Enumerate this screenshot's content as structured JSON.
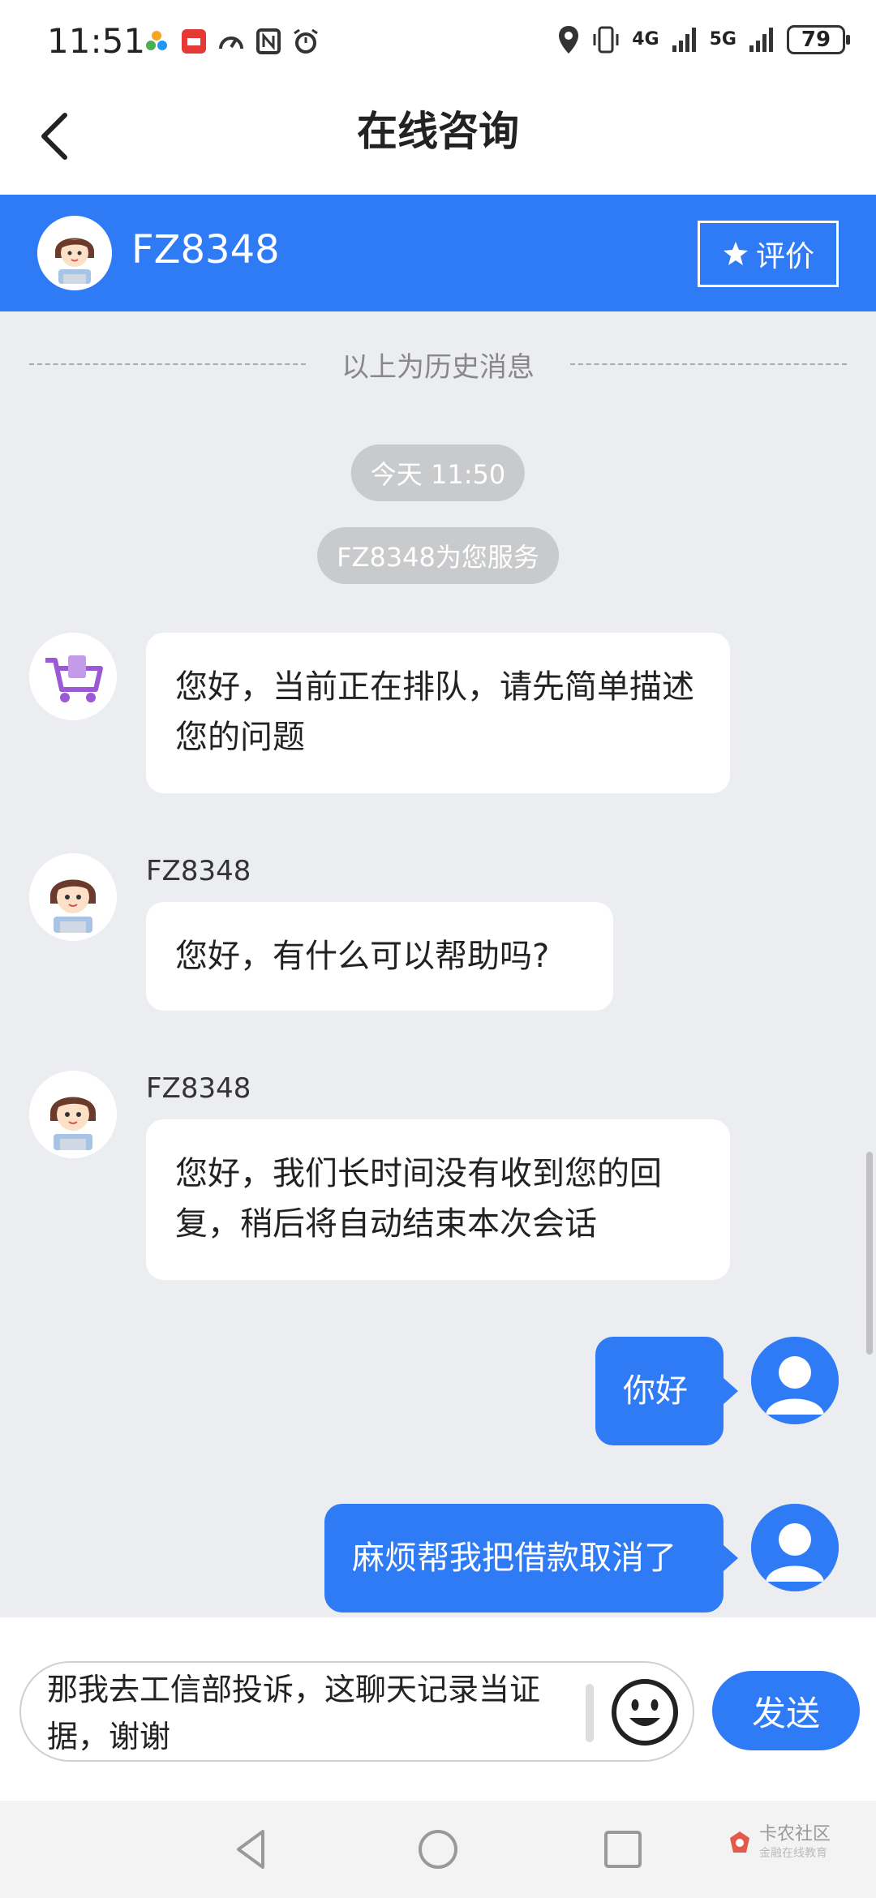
{
  "status_bar": {
    "time": "11:51",
    "battery": "79",
    "signal1": "4G",
    "signal2": "5G"
  },
  "header": {
    "title": "在线咨询",
    "back_icon": "chevron-left-icon"
  },
  "agent": {
    "name": "FZ8348",
    "rate_label": "评价"
  },
  "chat": {
    "history_label": "以上为历史消息",
    "time_label": "今天 11:50",
    "service_label": "FZ8348为您服务",
    "messages": [
      {
        "from": "bot",
        "text": "您好，当前正在排队，请先简单描述您的问题"
      },
      {
        "from": "agent",
        "sender": "FZ8348",
        "text": "您好，有什么可以帮助吗?"
      },
      {
        "from": "agent",
        "sender": "FZ8348",
        "text": "您好，我们长时间没有收到您的回复，稍后将自动结束本次会话"
      },
      {
        "from": "user",
        "text": "你好"
      },
      {
        "from": "user",
        "text": "麻烦帮我把借款取消了"
      }
    ]
  },
  "composer": {
    "value": "那我去工信部投诉，这聊天记录当证据，谢谢",
    "send_label": "发送"
  },
  "watermark": {
    "name": "卡农社区",
    "sub": "金融在线教育"
  },
  "colors": {
    "accent": "#2f7bf6",
    "background": "#ebedf0"
  }
}
